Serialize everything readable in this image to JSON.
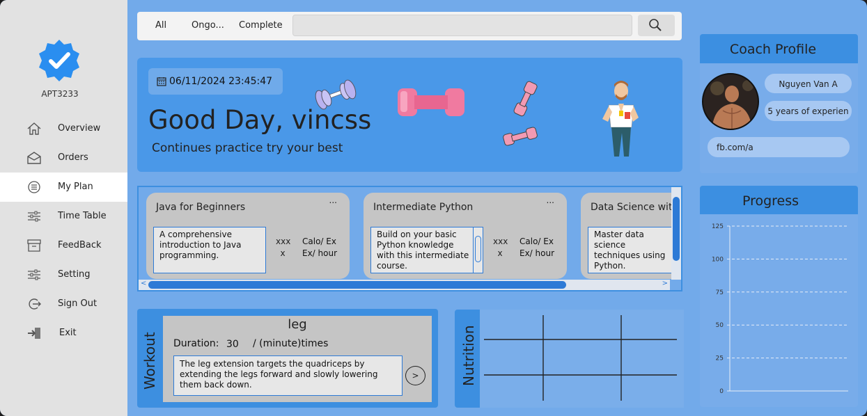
{
  "sidebar": {
    "app_name": "APT3233",
    "items": [
      {
        "label": "Overview",
        "icon": "home-icon"
      },
      {
        "label": "Orders",
        "icon": "envelope-icon"
      },
      {
        "label": "My Plan",
        "icon": "list-icon",
        "active": true
      },
      {
        "label": "Time Table",
        "icon": "sliders-icon"
      },
      {
        "label": "FeedBack",
        "icon": "archive-icon"
      },
      {
        "label": "Setting",
        "icon": "settings-sliders-icon"
      },
      {
        "label": "Sign Out",
        "icon": "sign-out-icon"
      },
      {
        "label": "Exit",
        "icon": "exit-icon"
      }
    ]
  },
  "filter": {
    "tabs": [
      "All",
      "Ongo...",
      "Complete"
    ],
    "search_value": "",
    "search_icon": "magnifier-icon"
  },
  "hero": {
    "datetime": "06/11/2024 23:45:47",
    "greeting": "Good Day, vincss",
    "subtitle": "Continues practice try your best"
  },
  "coach": {
    "title": "Coach Profile",
    "name": "Nguyen Van A",
    "experience": "5 years of experien",
    "link": "fb.com/a"
  },
  "courses": [
    {
      "title": "Java for Beginners",
      "menu": "...",
      "description": "A comprehensive introduction to Java programming.",
      "xxx": "xxx",
      "x": "x",
      "calo": "Calo/ Ex",
      "per": "Ex/ hour"
    },
    {
      "title": "Intermediate Python",
      "menu": "...",
      "description": "Build on your basic Python knowledge with this intermediate course.",
      "xxx": "xxx",
      "x": "x",
      "calo": "Calo/ Ex",
      "per": "Ex/ hour"
    },
    {
      "title": "Data Science with",
      "menu": "",
      "description": "Master data science techniques using Python.",
      "xxx": "",
      "x": "",
      "calo": "",
      "per": ""
    }
  ],
  "workout": {
    "side_label": "Workout",
    "exercise": "leg",
    "duration_label": "Duration:",
    "duration_value": "30",
    "unit": "/ (minute)times",
    "description": "The leg extension targets the quadriceps by extending the legs forward and slowly lowering them back down.",
    "next_button": ">"
  },
  "nutrition": {
    "side_label": "Nutrition"
  },
  "progress": {
    "title": "Progress"
  },
  "chart_data": {
    "type": "line",
    "title": "",
    "xlabel": "",
    "ylabel": "",
    "ylim": [
      0,
      125
    ],
    "yticks": [
      0,
      25,
      50,
      75,
      100,
      125
    ],
    "series": [],
    "grid": true
  },
  "colors": {
    "accent": "#3c8fe1",
    "background": "#72aaea",
    "sidebar": "#e2e2e2"
  }
}
